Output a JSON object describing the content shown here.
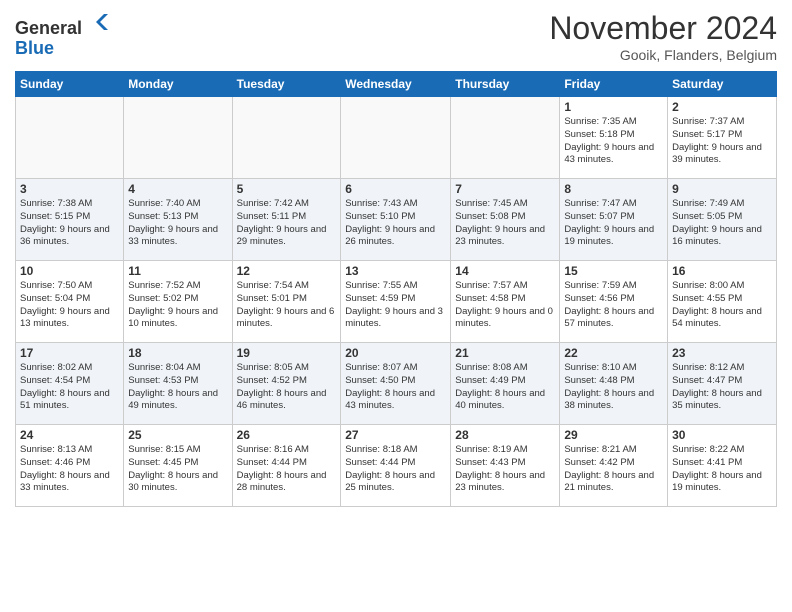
{
  "header": {
    "logo_line1": "General",
    "logo_line2": "Blue",
    "month": "November 2024",
    "location": "Gooik, Flanders, Belgium"
  },
  "weekdays": [
    "Sunday",
    "Monday",
    "Tuesday",
    "Wednesday",
    "Thursday",
    "Friday",
    "Saturday"
  ],
  "weeks": [
    [
      {
        "day": "",
        "info": ""
      },
      {
        "day": "",
        "info": ""
      },
      {
        "day": "",
        "info": ""
      },
      {
        "day": "",
        "info": ""
      },
      {
        "day": "",
        "info": ""
      },
      {
        "day": "1",
        "info": "Sunrise: 7:35 AM\nSunset: 5:18 PM\nDaylight: 9 hours and 43 minutes."
      },
      {
        "day": "2",
        "info": "Sunrise: 7:37 AM\nSunset: 5:17 PM\nDaylight: 9 hours and 39 minutes."
      }
    ],
    [
      {
        "day": "3",
        "info": "Sunrise: 7:38 AM\nSunset: 5:15 PM\nDaylight: 9 hours and 36 minutes."
      },
      {
        "day": "4",
        "info": "Sunrise: 7:40 AM\nSunset: 5:13 PM\nDaylight: 9 hours and 33 minutes."
      },
      {
        "day": "5",
        "info": "Sunrise: 7:42 AM\nSunset: 5:11 PM\nDaylight: 9 hours and 29 minutes."
      },
      {
        "day": "6",
        "info": "Sunrise: 7:43 AM\nSunset: 5:10 PM\nDaylight: 9 hours and 26 minutes."
      },
      {
        "day": "7",
        "info": "Sunrise: 7:45 AM\nSunset: 5:08 PM\nDaylight: 9 hours and 23 minutes."
      },
      {
        "day": "8",
        "info": "Sunrise: 7:47 AM\nSunset: 5:07 PM\nDaylight: 9 hours and 19 minutes."
      },
      {
        "day": "9",
        "info": "Sunrise: 7:49 AM\nSunset: 5:05 PM\nDaylight: 9 hours and 16 minutes."
      }
    ],
    [
      {
        "day": "10",
        "info": "Sunrise: 7:50 AM\nSunset: 5:04 PM\nDaylight: 9 hours and 13 minutes."
      },
      {
        "day": "11",
        "info": "Sunrise: 7:52 AM\nSunset: 5:02 PM\nDaylight: 9 hours and 10 minutes."
      },
      {
        "day": "12",
        "info": "Sunrise: 7:54 AM\nSunset: 5:01 PM\nDaylight: 9 hours and 6 minutes."
      },
      {
        "day": "13",
        "info": "Sunrise: 7:55 AM\nSunset: 4:59 PM\nDaylight: 9 hours and 3 minutes."
      },
      {
        "day": "14",
        "info": "Sunrise: 7:57 AM\nSunset: 4:58 PM\nDaylight: 9 hours and 0 minutes."
      },
      {
        "day": "15",
        "info": "Sunrise: 7:59 AM\nSunset: 4:56 PM\nDaylight: 8 hours and 57 minutes."
      },
      {
        "day": "16",
        "info": "Sunrise: 8:00 AM\nSunset: 4:55 PM\nDaylight: 8 hours and 54 minutes."
      }
    ],
    [
      {
        "day": "17",
        "info": "Sunrise: 8:02 AM\nSunset: 4:54 PM\nDaylight: 8 hours and 51 minutes."
      },
      {
        "day": "18",
        "info": "Sunrise: 8:04 AM\nSunset: 4:53 PM\nDaylight: 8 hours and 49 minutes."
      },
      {
        "day": "19",
        "info": "Sunrise: 8:05 AM\nSunset: 4:52 PM\nDaylight: 8 hours and 46 minutes."
      },
      {
        "day": "20",
        "info": "Sunrise: 8:07 AM\nSunset: 4:50 PM\nDaylight: 8 hours and 43 minutes."
      },
      {
        "day": "21",
        "info": "Sunrise: 8:08 AM\nSunset: 4:49 PM\nDaylight: 8 hours and 40 minutes."
      },
      {
        "day": "22",
        "info": "Sunrise: 8:10 AM\nSunset: 4:48 PM\nDaylight: 8 hours and 38 minutes."
      },
      {
        "day": "23",
        "info": "Sunrise: 8:12 AM\nSunset: 4:47 PM\nDaylight: 8 hours and 35 minutes."
      }
    ],
    [
      {
        "day": "24",
        "info": "Sunrise: 8:13 AM\nSunset: 4:46 PM\nDaylight: 8 hours and 33 minutes."
      },
      {
        "day": "25",
        "info": "Sunrise: 8:15 AM\nSunset: 4:45 PM\nDaylight: 8 hours and 30 minutes."
      },
      {
        "day": "26",
        "info": "Sunrise: 8:16 AM\nSunset: 4:44 PM\nDaylight: 8 hours and 28 minutes."
      },
      {
        "day": "27",
        "info": "Sunrise: 8:18 AM\nSunset: 4:44 PM\nDaylight: 8 hours and 25 minutes."
      },
      {
        "day": "28",
        "info": "Sunrise: 8:19 AM\nSunset: 4:43 PM\nDaylight: 8 hours and 23 minutes."
      },
      {
        "day": "29",
        "info": "Sunrise: 8:21 AM\nSunset: 4:42 PM\nDaylight: 8 hours and 21 minutes."
      },
      {
        "day": "30",
        "info": "Sunrise: 8:22 AM\nSunset: 4:41 PM\nDaylight: 8 hours and 19 minutes."
      }
    ]
  ]
}
